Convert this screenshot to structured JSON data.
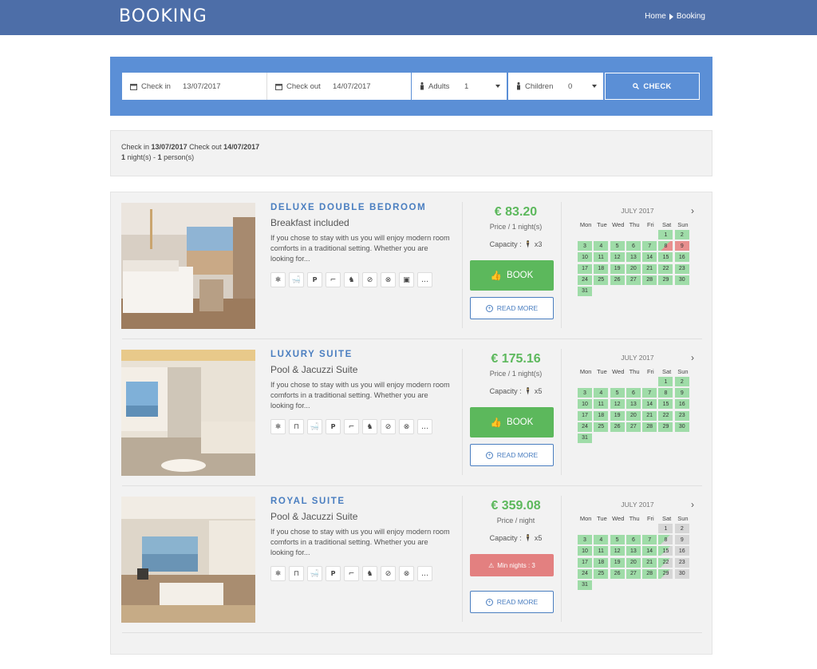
{
  "header": {
    "title": "BOOKING",
    "breadcrumb": {
      "home": "Home",
      "current": "Booking"
    }
  },
  "search": {
    "checkin_label": "Check in",
    "checkin_value": "13/07/2017",
    "checkout_label": "Check out",
    "checkout_value": "14/07/2017",
    "adults_label": "Adults",
    "adults_value": "1",
    "children_label": "Children",
    "children_value": "0",
    "check_button": "CHECK"
  },
  "summary": {
    "checkin_prefix": "Check in",
    "checkin_date": "13/07/2017",
    "checkout_prefix": "Check out",
    "checkout_date": "14/07/2017",
    "nights_count": "1",
    "nights_text": "night(s) -",
    "persons_count": "1",
    "persons_text": "person(s)"
  },
  "calendar_day_names": [
    "Mon",
    "Tue",
    "Wed",
    "Thu",
    "Fri",
    "Sat",
    "Sun"
  ],
  "rooms": [
    {
      "name": "DELUXE DOUBLE BEDROOM",
      "subtitle": "Breakfast included",
      "description": "If you chose to stay with us you will enjoy modern room comforts in a traditional setting. Whether you are looking for...",
      "amenities": [
        "snowflake-icon",
        "bathtub-icon",
        "parking-icon",
        "hairdryer-icon",
        "pets-icon",
        "no-smoking-icon",
        "no-drinks-icon",
        "safe-icon",
        "more-icon"
      ],
      "price": "€ 83.20",
      "price_unit": "Price / 1 night(s)",
      "capacity_label": "Capacity :",
      "capacity_value": "x3",
      "action": "BOOK",
      "read_more": "READ MORE",
      "calendar_month": "JULY 2017"
    },
    {
      "name": "LUXURY SUITE",
      "subtitle": "Pool & Jacuzzi Suite",
      "description": "If you chose to stay with us you will enjoy modern room comforts in a traditional setting. Whether you are looking for...",
      "amenities": [
        "snowflake-icon",
        "bed-icon",
        "bathtub-icon",
        "parking-icon",
        "hairdryer-icon",
        "pets-icon",
        "no-smoking-icon",
        "no-drinks-icon",
        "more-icon"
      ],
      "price": "€ 175.16",
      "price_unit": "Price / 1 night(s)",
      "capacity_label": "Capacity :",
      "capacity_value": "x5",
      "action": "BOOK",
      "read_more": "READ MORE",
      "calendar_month": "JULY 2017"
    },
    {
      "name": "ROYAL SUITE",
      "subtitle": "Pool & Jacuzzi Suite",
      "description": "If you chose to stay with us you will enjoy modern room comforts in a traditional setting. Whether you are looking for...",
      "amenities": [
        "snowflake-icon",
        "bed-icon",
        "bathtub-icon",
        "parking-icon",
        "hairdryer-icon",
        "pets-icon",
        "no-smoking-icon",
        "no-drinks-icon",
        "more-icon"
      ],
      "price": "€ 359.08",
      "price_unit": "Price / night",
      "capacity_label": "Capacity :",
      "capacity_value": "x5",
      "action": "Min nights : 3",
      "read_more": "READ MORE",
      "calendar_month": "JULY 2017"
    }
  ],
  "colors": {
    "header": "#4d6ea8",
    "search_bar": "#5b8fd6",
    "accent_blue": "#4a7ec0",
    "price_green": "#5cb85c",
    "available": "#9fdca8",
    "booked": "#e88f8f",
    "unavailable": "#d6d6d6",
    "min_nights": "#e38080"
  }
}
